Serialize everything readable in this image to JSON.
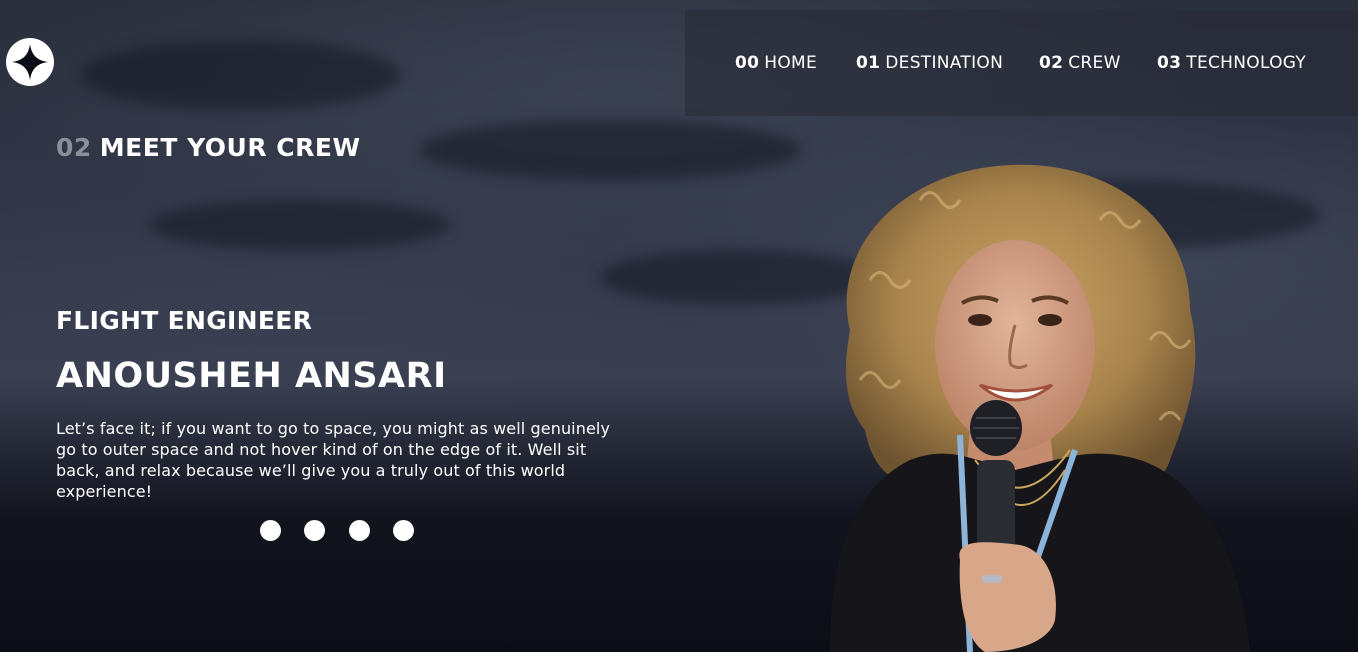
{
  "brand": {
    "logo_icon": "four-point-star-icon"
  },
  "nav": {
    "items": [
      {
        "num": "00",
        "label": "HOME"
      },
      {
        "num": "01",
        "label": "DESTINATION"
      },
      {
        "num": "02",
        "label": "CREW"
      },
      {
        "num": "03",
        "label": "TECHNOLOGY"
      }
    ]
  },
  "page": {
    "section_num": "02",
    "section_title": "MEET YOUR CREW"
  },
  "crew": {
    "role": "FLIGHT ENGINEER",
    "name": "ANOUSHEH ANSARI",
    "bio": "Let’s face it; if you want to go to space, you might as well genuinely go to outer space and not hover kind of on the edge of it. Well sit back, and relax because we’ll give you a truly out of this world experience!"
  },
  "carousel": {
    "dot_count": 4
  },
  "colors": {
    "background": "#0b0d17",
    "text": "#ffffff",
    "muted_number": "#8c8f99"
  }
}
